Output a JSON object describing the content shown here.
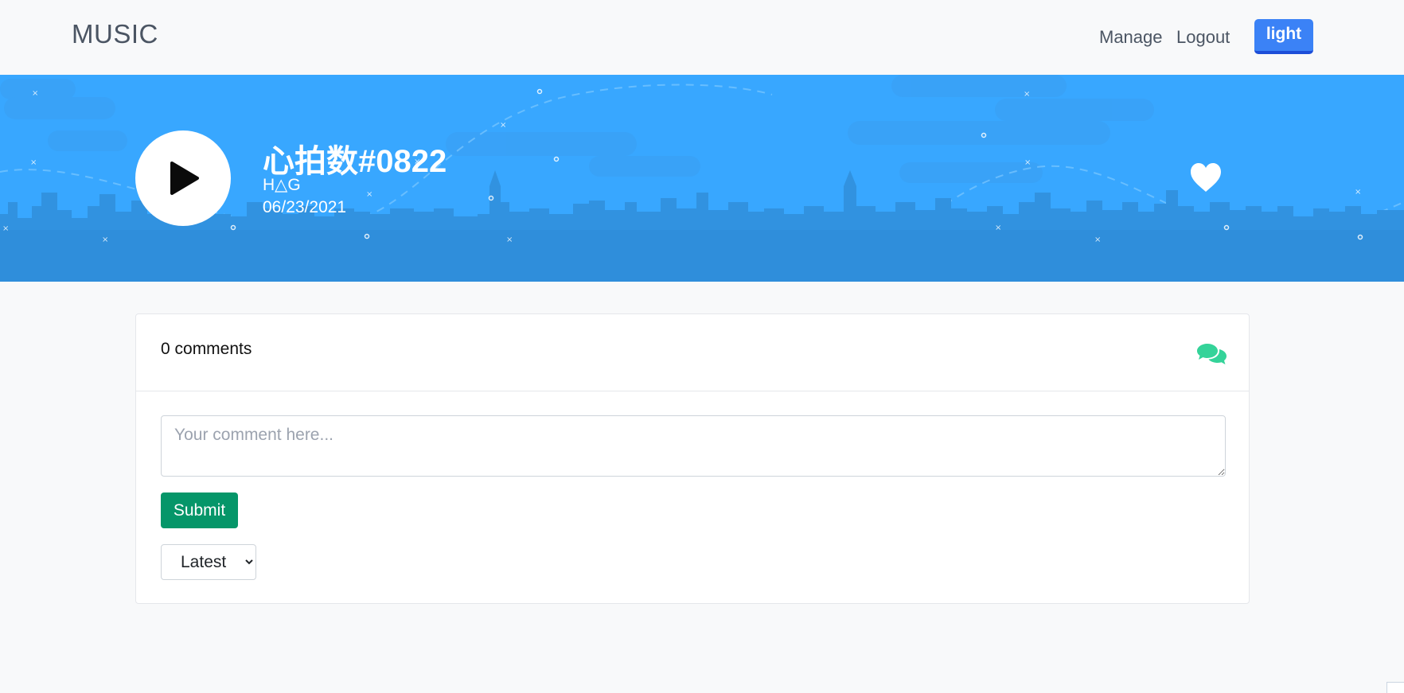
{
  "navbar": {
    "brand": "MUSIC",
    "links": [
      {
        "label": "Manage"
      },
      {
        "label": "Logout"
      }
    ],
    "theme_toggle": "light"
  },
  "song": {
    "title": "心拍数#0822",
    "artist": "H△G",
    "date": "06/23/2021"
  },
  "comments": {
    "count_label": "0 comments",
    "input_placeholder": "Your comment here...",
    "submit_label": "Submit",
    "sort_options": [
      "Latest"
    ],
    "sort_selected": "Latest"
  },
  "colors": {
    "hero_bg": "#38a7ff",
    "theme_button": "#3b82f6",
    "submit_button": "#059669",
    "comment_icon": "#34d399"
  },
  "icons": {
    "play": "play-icon",
    "like": "heart-icon",
    "comments": "comments-icon"
  }
}
